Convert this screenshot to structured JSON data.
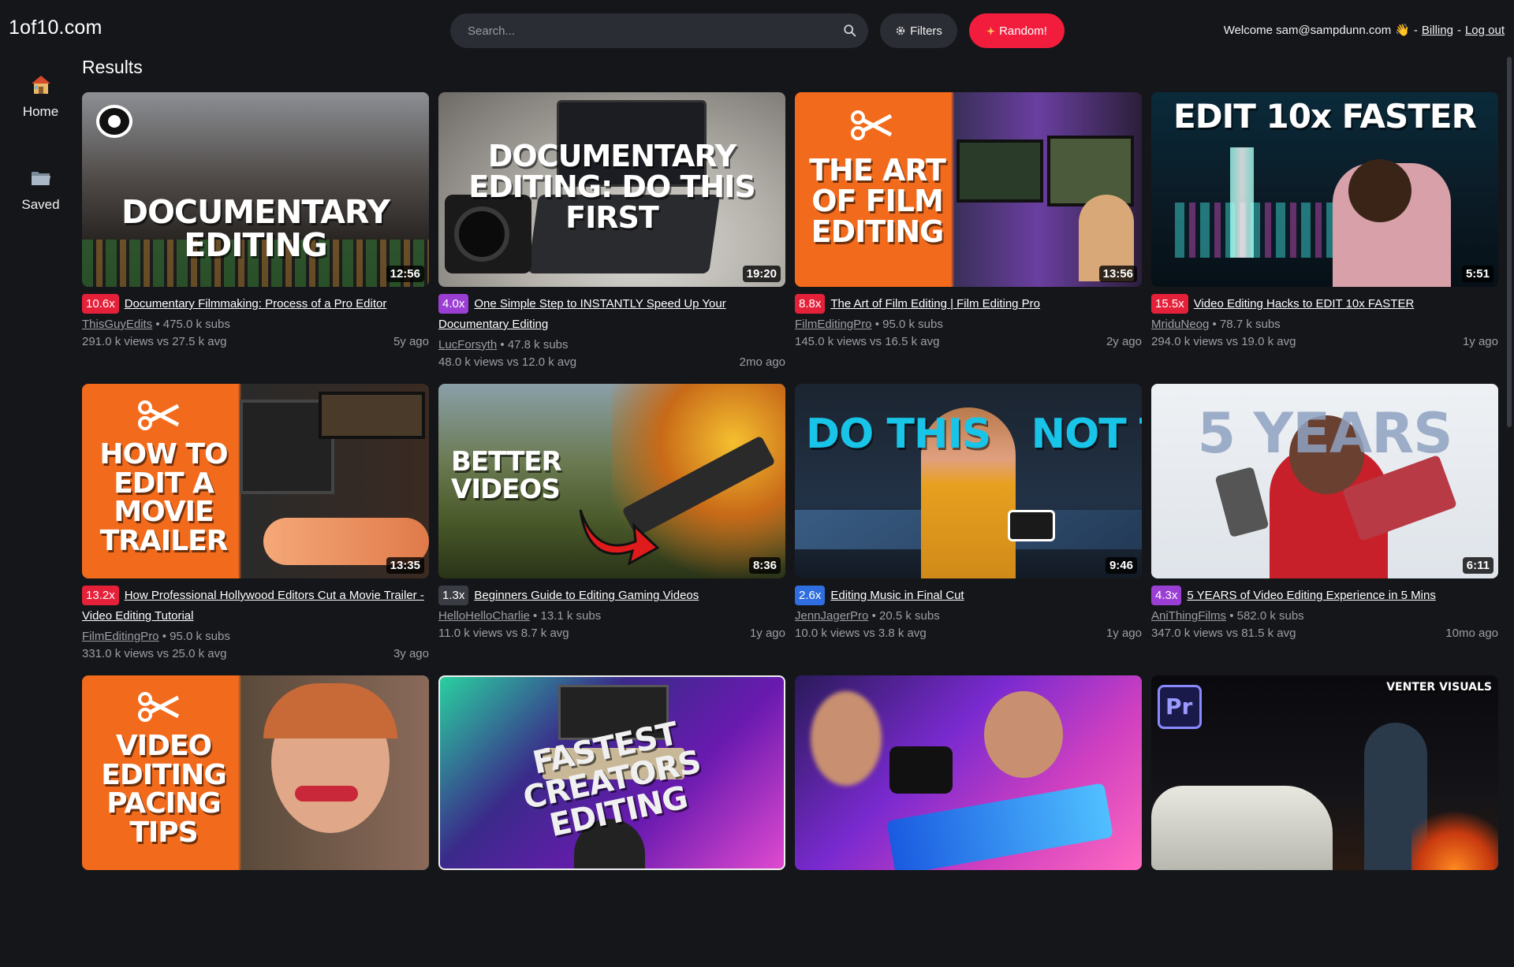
{
  "app": {
    "logo": "1of10.com"
  },
  "search": {
    "placeholder": "Search..."
  },
  "toolbar": {
    "filters_label": "Filters",
    "random_label": "Random!"
  },
  "user": {
    "welcome": "Welcome sam@sampdunn.com",
    "wave": "👋",
    "sep1": "-",
    "billing": "Billing",
    "sep2": "-",
    "logout": "Log out"
  },
  "sidebar": {
    "items": [
      {
        "label": "Home",
        "icon": "house-icon"
      },
      {
        "label": "Saved",
        "icon": "folder-icon"
      }
    ]
  },
  "main": {
    "title": "Results"
  },
  "colors": {
    "accent_red": "#f21d3d",
    "badge_red": "#e5213a",
    "badge_purple": "#9b3fd4",
    "badge_blue": "#2f6ee0",
    "badge_gray": "#3a3c44"
  },
  "videos": [
    {
      "thumb_text": "DOCUMENTARY EDITING",
      "duration": "12:56",
      "multiplier": "10.6x",
      "badge_color": "#e5213a",
      "title": "Documentary Filmmaking: Process of a Pro Editor",
      "channel": "ThisGuyEdits",
      "subs": "475.0 k subs",
      "views": "291.0 k views vs 27.5 k avg",
      "age": "5y ago"
    },
    {
      "thumb_text": "DOCUMENTARY EDITING: DO THIS FIRST",
      "duration": "19:20",
      "multiplier": "4.0x",
      "badge_color": "#9b3fd4",
      "title": "One Simple Step to INSTANTLY Speed Up Your Documentary Editing",
      "channel": "LucForsyth",
      "subs": "47.8 k subs",
      "views": "48.0 k views vs 12.0 k avg",
      "age": "2mo ago"
    },
    {
      "thumb_text": "THE ART OF FILM EDITING",
      "duration": "13:56",
      "multiplier": "8.8x",
      "badge_color": "#e5213a",
      "title": "The Art of Film Editing | Film Editing Pro",
      "channel": "FilmEditingPro",
      "subs": "95.0 k subs",
      "views": "145.0 k views vs 16.5 k avg",
      "age": "2y ago"
    },
    {
      "thumb_text": "EDIT 10x FASTER",
      "duration": "5:51",
      "multiplier": "15.5x",
      "badge_color": "#e5213a",
      "title": "Video Editing Hacks to EDIT 10x FASTER",
      "channel": "MriduNeog",
      "subs": "78.7 k subs",
      "views": "294.0 k views vs 19.0 k avg",
      "age": "1y ago"
    },
    {
      "thumb_text": "HOW TO EDIT A MOVIE TRAILER",
      "duration": "13:35",
      "multiplier": "13.2x",
      "badge_color": "#e5213a",
      "title": "How Professional Hollywood Editors Cut a Movie Trailer - Video Editing Tutorial",
      "channel": "FilmEditingPro",
      "subs": "95.0 k subs",
      "views": "331.0 k views vs 25.0 k avg",
      "age": "3y ago"
    },
    {
      "thumb_text": "BETTER VIDEOS",
      "duration": "8:36",
      "multiplier": "1.3x",
      "badge_color": "#3a3c44",
      "title": "Beginners Guide to Editing Gaming Videos",
      "channel": "HelloHelloCharlie",
      "subs": "13.1 k subs",
      "views": "11.0 k views vs 8.7 k avg",
      "age": "1y ago"
    },
    {
      "thumb_text": "DO THIS   NOT THIS",
      "duration": "9:46",
      "multiplier": "2.6x",
      "badge_color": "#2f6ee0",
      "title": "Editing Music in Final Cut",
      "channel": "JennJagerPro",
      "subs": "20.5 k subs",
      "views": "10.0 k views vs 3.8 k avg",
      "age": "1y ago"
    },
    {
      "thumb_text": "5 YEARS",
      "duration": "6:11",
      "multiplier": "4.3x",
      "badge_color": "#9b3fd4",
      "title": "5 YEARS of Video Editing Experience in 5 Mins",
      "channel": "AniThingFilms",
      "subs": "582.0 k subs",
      "views": "347.0 k views vs 81.5 k avg",
      "age": "10mo ago"
    },
    {
      "thumb_text": "VIDEO EDITING PACING TIPS",
      "duration": "",
      "multiplier": "",
      "badge_color": "#e5213a",
      "title": "",
      "channel": "",
      "subs": "",
      "views": "",
      "age": ""
    },
    {
      "thumb_text": "FASTEST CREATORS EDITING",
      "duration": "",
      "multiplier": "",
      "badge_color": "#e5213a",
      "title": "",
      "channel": "",
      "subs": "",
      "views": "",
      "age": ""
    },
    {
      "thumb_text": "",
      "duration": "",
      "multiplier": "",
      "badge_color": "#e5213a",
      "title": "",
      "channel": "",
      "subs": "",
      "views": "",
      "age": ""
    },
    {
      "thumb_text": "VENTER VISUALS",
      "duration": "",
      "multiplier": "",
      "badge_color": "#e5213a",
      "title": "",
      "channel": "",
      "subs": "",
      "views": "",
      "age": ""
    }
  ]
}
